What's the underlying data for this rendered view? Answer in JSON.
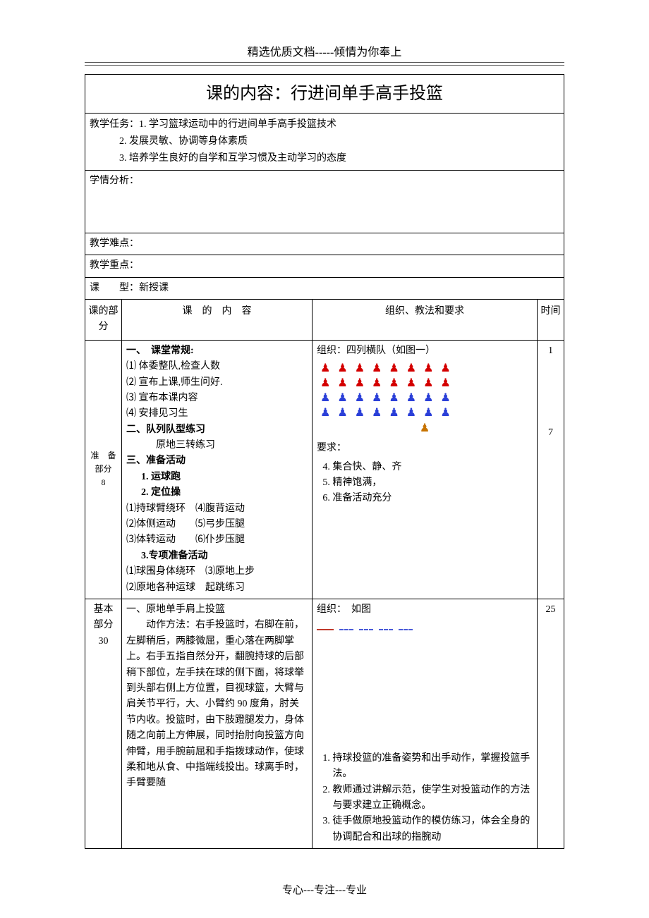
{
  "header": "精选优质文档-----倾情为你奉上",
  "footer": "专心---专注---专业",
  "title": "课的内容：行进间单手高手投篮",
  "tasks_label": "教学任务：",
  "tasks": [
    "1. 学习篮球运动中的行进间单手高手投篮技术",
    "2. 发展灵敏、协调等身体素质",
    "3. 培养学生良好的自学和互学习惯及主动学习的态度"
  ],
  "analysis_label": "学情分析：",
  "difficulty_label": "教学难点：",
  "keypoint_label": "教学重点：",
  "type_label": "课　　型：",
  "type_value": "新授课",
  "table_head": {
    "part": "课的部分",
    "content": "课　的　内　容",
    "org": "组织、教法和要求",
    "time": "时间"
  },
  "prep": {
    "part_label": "准　备部分",
    "part_num": "8",
    "times": [
      "1",
      "7"
    ],
    "s1_title": "一、　课堂常规:",
    "s1_items": [
      "⑴ 体委整队,检查人数",
      "⑵ 宣布上课,师生问好.",
      "⑶ 宣布本课内容",
      "⑷ 安排见习生"
    ],
    "s2_title": "二、队列队型练习",
    "s2_sub": "原地三转练习",
    "s3_title": "三、准备活动",
    "s3_a": "1. 运球跑",
    "s3_b": "2. 定位操",
    "s3_b_items": [
      "⑴持球臂绕环　⑷腹背运动",
      "⑵体侧运动　　⑸弓步压腿",
      "⑶体转运动　　⑹仆步压腿"
    ],
    "s3_c": "3.专项准备活动",
    "s3_c_items": [
      "⑴球围身体绕环　⑶原地上步",
      "⑵原地各种运球　起跳练习"
    ],
    "org_label": "组织：",
    "org_text": "四列横队（如图一）",
    "req_label": "要求：",
    "reqs": [
      "集合快、静、齐",
      "精神饱满，",
      "准备活动充分"
    ]
  },
  "basic": {
    "part_label": "基本部分",
    "part_num": "30",
    "time": "25",
    "c_title": "一、原地单手肩上投篮",
    "c_sub": "动作方法：",
    "c_body": "右手投篮时，右脚在前，左脚稍后，两膝微屈，重心落在两脚掌上。右手五指自然分开，翻腕持球的后部稍下部位，左手扶在球的侧下面，将球举到头部右侧上方位置，目视球篮，大臂与肩关节平行，大、小臂约 90 度角，肘关节内收。投篮时，由下肢蹬腿发力，身体随之向前上方伸展，同时抬肘向投篮方向伸臂，用手腕前屈和手指拨球动作，使球柔和地从食、中指端线投出。球离手时，手臂要随",
    "org_label": "组织：",
    "org_text": "如图",
    "points": [
      "持球投篮的准备姿势和出手动作，掌握投篮手法。",
      "教师通过讲解示范，使学生对投篮动作的方法与要求建立正确概念。",
      "徒手做原地投篮动作的模仿练习，体会全身的协调配合和出球的指腕动"
    ]
  }
}
